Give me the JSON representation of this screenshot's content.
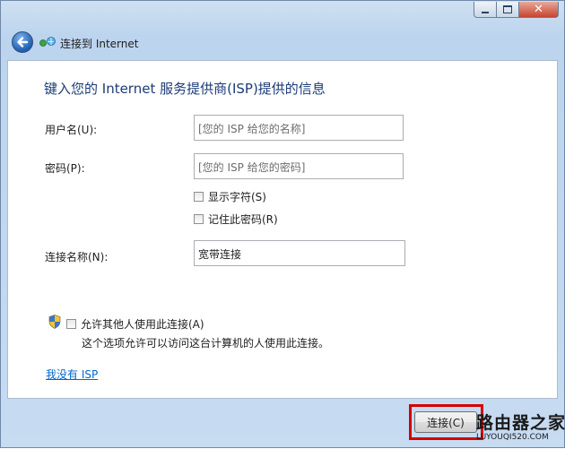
{
  "nav": {
    "title": "连接到 Internet"
  },
  "heading": "键入您的 Internet 服务提供商(ISP)提供的信息",
  "form": {
    "username": {
      "label": "用户名(U):",
      "placeholder": "[您的 ISP 给您的名称]",
      "value": ""
    },
    "password": {
      "label": "密码(P):",
      "placeholder": "[您的 ISP 给您的密码]",
      "value": ""
    },
    "show_chars": {
      "label": "显示字符(S)",
      "checked": false
    },
    "remember_password": {
      "label": "记住此密码(R)",
      "checked": false
    },
    "connection_name": {
      "label": "连接名称(N):",
      "value": "宽带连接"
    },
    "allow_others": {
      "label": "允许其他人使用此连接(A)",
      "checked": false,
      "description": "这个选项允许可以访问这台计算机的人使用此连接。"
    }
  },
  "no_isp_link": "我没有 ISP",
  "buttons": {
    "connect": "连接(C)"
  },
  "watermark": {
    "cn": "路由器之家",
    "url": "LUYOUQI520.COM"
  },
  "icons": [
    "minimize-icon",
    "maximize-icon",
    "close-icon",
    "back-arrow-icon",
    "network-icon",
    "shield-icon"
  ]
}
